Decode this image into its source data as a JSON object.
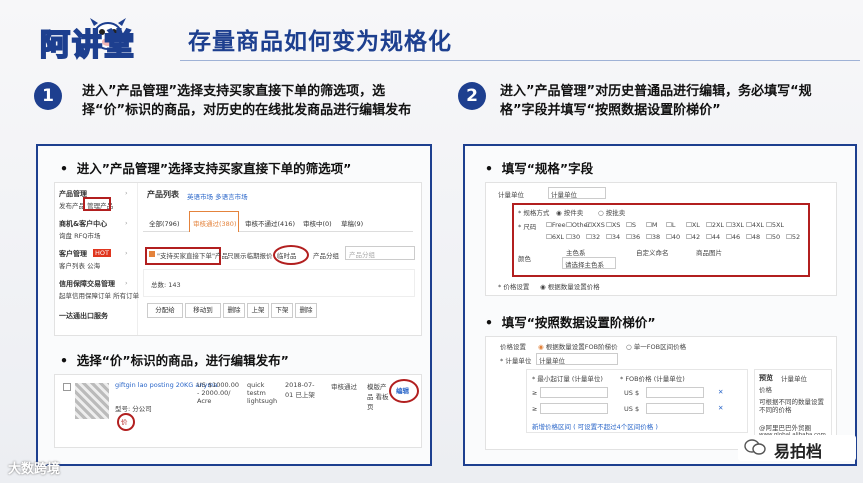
{
  "header": {
    "logo_text": "阿讲堂",
    "title": "存量商品如何变为规格化"
  },
  "steps": [
    {
      "number": "1",
      "text": "进入”产品管理”选择支持买家直接下单的筛选项，选择“价”标识的商品，对历史的在线批发商品进行编辑发布"
    },
    {
      "number": "2",
      "text": "进入”产品管理”对历史普通品进行编辑，务必填写“规格”字段并填写“按照数据设置阶梯价”"
    }
  ],
  "left_panel": {
    "bullet1": "进入”产品管理”选择支持买家直接下单的筛选项”",
    "bullet2": "选择“价”标识的商品，进行编辑发布”",
    "sidebar": [
      {
        "title": "产品管理",
        "sub": "发布产品  管理产品"
      },
      {
        "title": "商机&客户中心",
        "sub": "询盘  RFQ市场"
      },
      {
        "title": "客户管理",
        "badge": "HOT",
        "sub": "客户列表  公海"
      },
      {
        "title": "信用保障交易管理",
        "sub": "起草信用保障订单  所有订单"
      },
      {
        "title": "一达通出口服务",
        "sub": ""
      }
    ],
    "list_title": "产品列表",
    "list_links": "英语市场   多语言市场",
    "tabs": [
      "全部(796)",
      "审核通过(380)",
      "审核不通过(416)",
      "审核中(0)",
      "草稿(9)"
    ],
    "filter_checkbox": "\"支持买家直接下单\"产品",
    "filter_options": [
      "只展示临期报价",
      "临时品"
    ],
    "group_label": "产品分组",
    "group_placeholder": "产品分组",
    "total": "总数: 143",
    "toolbar": [
      "分配给",
      "移动到",
      "删除",
      "上架",
      "下架",
      "删除"
    ],
    "product_row": {
      "name": "giftgin lao posting 20KG anyma",
      "price": "US $1000.00 - 2000.00/ Acre",
      "stock": "quick testm lightsugh",
      "date": "2018-07-01 已上架",
      "status": "审核通过",
      "extra": "模版产品 看板页",
      "model": "型号: 分公司",
      "price_mark": "价",
      "edit": "编辑"
    }
  },
  "right_panel": {
    "bullet1": "填写“规格”字段",
    "bullet2": "填写“按照数据设置阶梯价”",
    "spec": {
      "unit_label": "计量单位",
      "unit_value": "计量单位",
      "mode_label": "* 规格方式",
      "mode_options": [
        "按件卖",
        "按批卖"
      ],
      "size_label": "* 尺码",
      "sizes_row1": [
        "Free",
        "Other",
        "XXS",
        "XS",
        "S",
        "M",
        "L",
        "XL",
        "2XL",
        "3XL",
        "4XL",
        "5XL"
      ],
      "sizes_row2": [
        "6XL",
        "30",
        "32",
        "34",
        "36",
        "38",
        "40",
        "42",
        "44",
        "46",
        "48",
        "50",
        "52"
      ],
      "color_label": "颜色",
      "color_cols": [
        "主色系",
        "自定义命名",
        "商品图片"
      ],
      "color_select": "请选择主色系",
      "price_setting_label": "* 价格设置",
      "price_setting_option": "根据数量设置价格"
    },
    "tier": {
      "price_setting_label": "价格设置",
      "options": [
        "根据数量设置FOB阶梯价",
        "单一FOB区间价格"
      ],
      "unit_label": "* 计量单位",
      "unit_value": "计量单位",
      "col1": "* 最小起订量 (计量单位)",
      "col2": "* FOB价格 (计量单位)",
      "currency": "US $",
      "ge": "≥",
      "add_link": "新增价格区间 ( 可设置不超过4个区间价格 )",
      "preview_title": "预览",
      "preview_sub": "计量单位",
      "preview_col": "价格",
      "preview_note": "可根据不同的数量设置不同的价格",
      "preview_company": "@阿里巴巴外贸圈",
      "preview_site": "www.global.alibaba.com"
    }
  },
  "watermarks": {
    "left": "大数跨境",
    "right": "易拍档"
  }
}
